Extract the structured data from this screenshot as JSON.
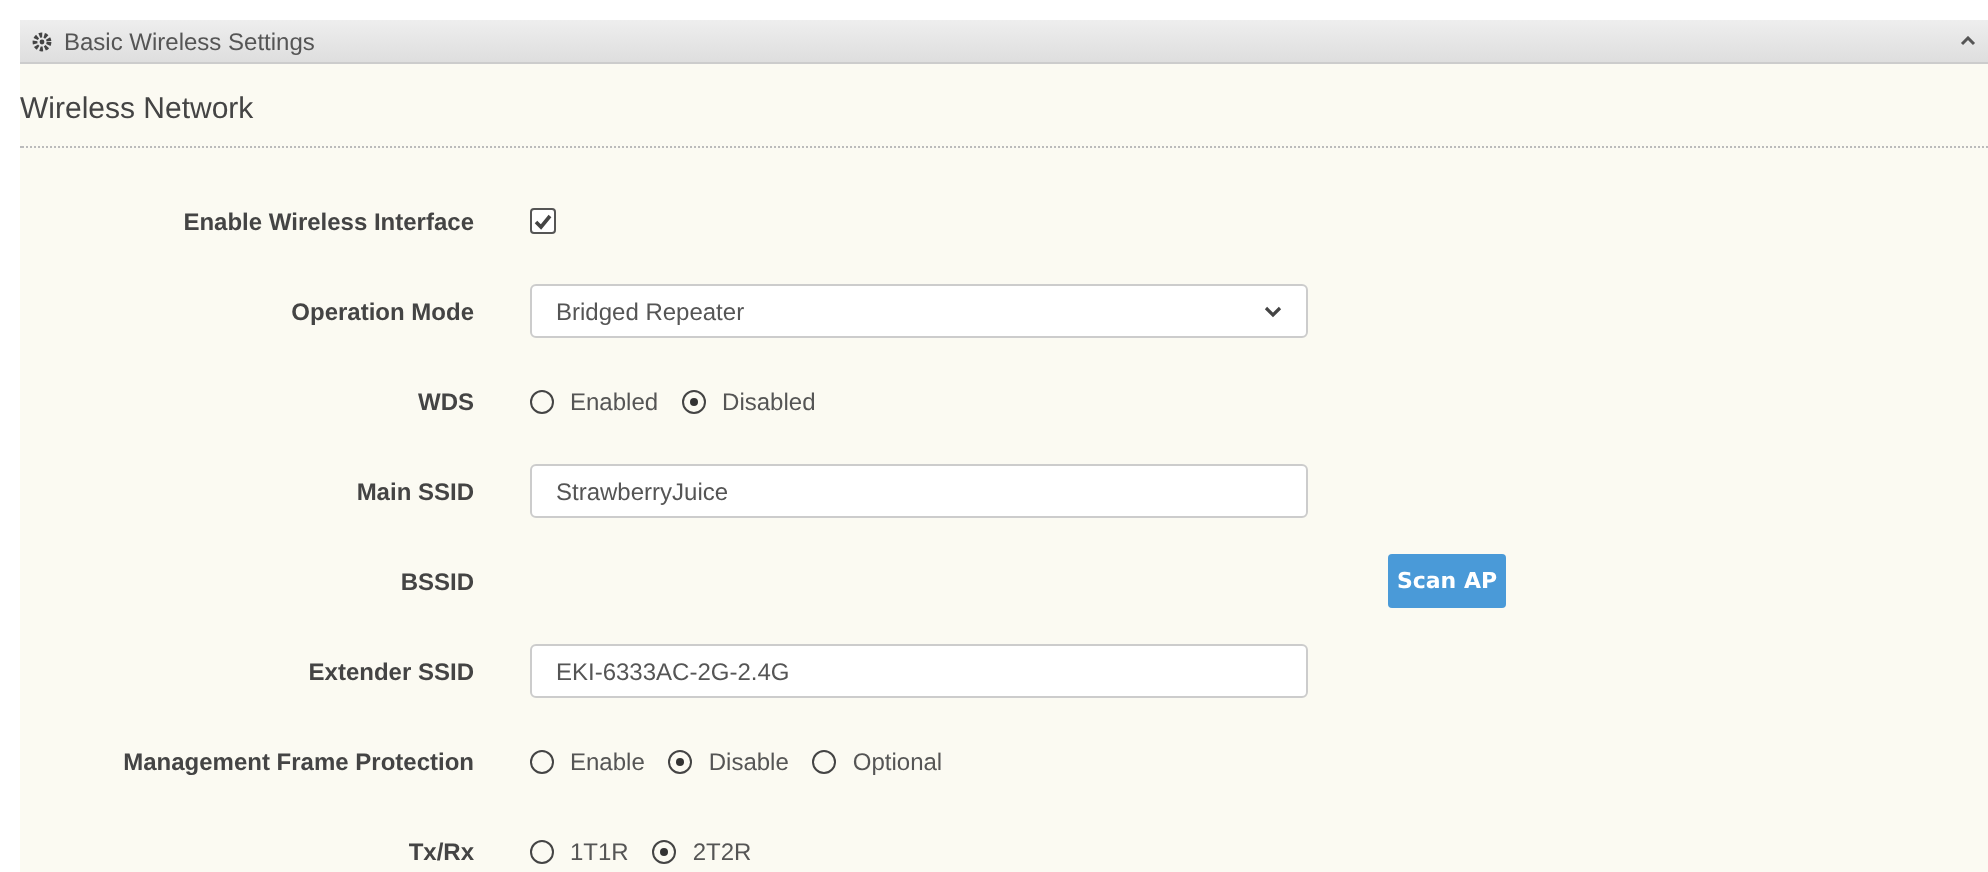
{
  "panel": {
    "title": "Basic Wireless Settings",
    "expanded": true
  },
  "section": {
    "title": "Wireless Network"
  },
  "rows": [
    {
      "kind": "checkbox",
      "label": "Enable Wireless Interface",
      "checked": true
    },
    {
      "kind": "select",
      "label": "Operation Mode",
      "value": "Bridged Repeater"
    },
    {
      "kind": "radio",
      "label": "WDS",
      "options": [
        {
          "label": "Enabled",
          "selected": false
        },
        {
          "label": "Disabled",
          "selected": true
        }
      ]
    },
    {
      "kind": "text",
      "label": "Main SSID",
      "value": "StrawberryJuice"
    },
    {
      "kind": "button",
      "label": "BSSID",
      "button": "Scan AP"
    },
    {
      "kind": "text",
      "label": "Extender SSID",
      "value": "EKI-6333AC-2G-2.4G"
    },
    {
      "kind": "radio",
      "label": "Management Frame Protection",
      "options": [
        {
          "label": "Enable",
          "selected": false
        },
        {
          "label": "Disable",
          "selected": true
        },
        {
          "label": "Optional",
          "selected": false
        }
      ]
    },
    {
      "kind": "radio",
      "label": "Tx/Rx",
      "options": [
        {
          "label": "1T1R",
          "selected": false
        },
        {
          "label": "2T2R",
          "selected": true
        }
      ]
    }
  ]
}
